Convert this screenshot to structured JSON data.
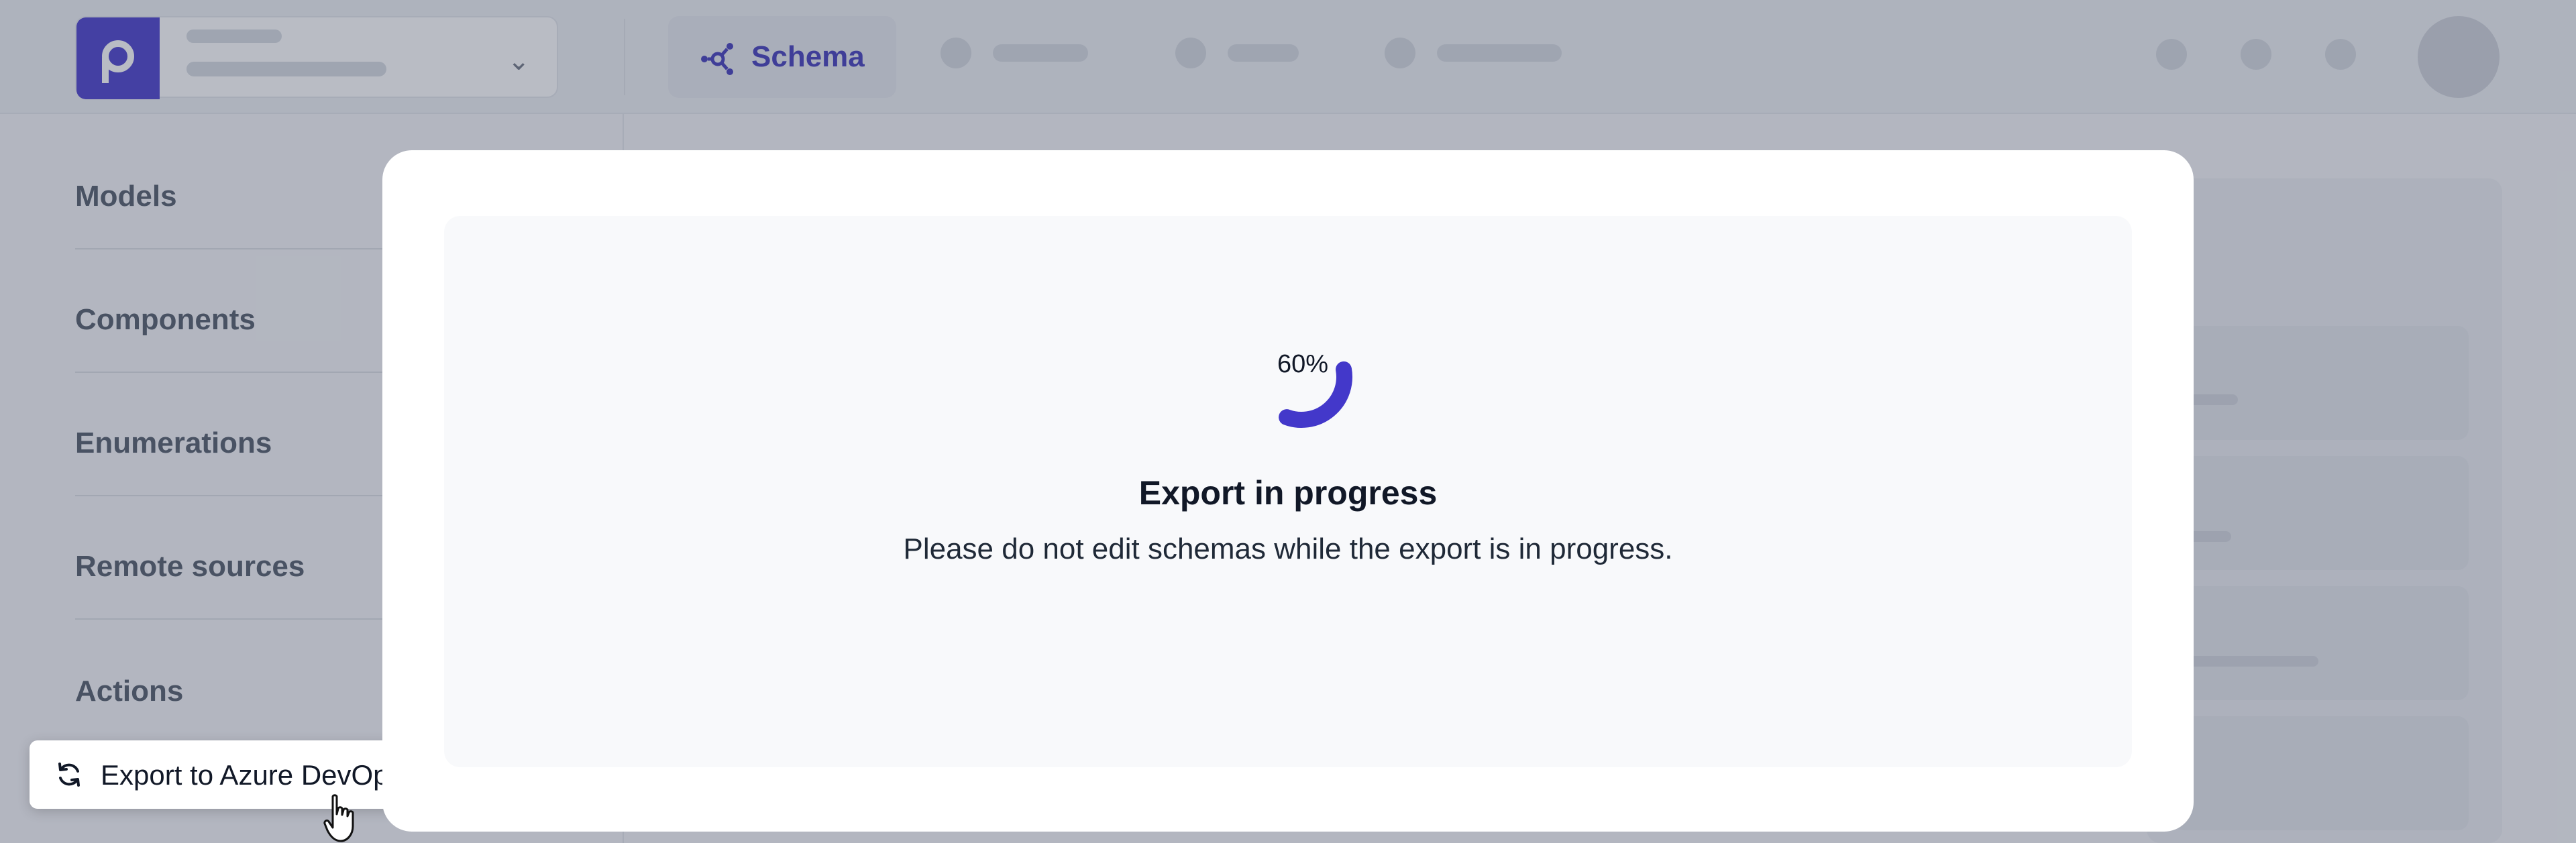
{
  "header": {
    "active_tab_label": "Schema",
    "accent_color": "#4338ca"
  },
  "sidebar": {
    "items": [
      {
        "label": "Models"
      },
      {
        "label": "Components"
      },
      {
        "label": "Enumerations"
      },
      {
        "label": "Remote sources"
      },
      {
        "label": "Actions"
      }
    ]
  },
  "export_menu": {
    "label": "Export to Azure DevOps",
    "icon": "refresh-icon"
  },
  "modal": {
    "progress_percent": 60,
    "progress_label": "60%",
    "title": "Export in progress",
    "message": "Please do not edit schemas while the export is in progress.",
    "spinner_color": "#4338ca"
  }
}
